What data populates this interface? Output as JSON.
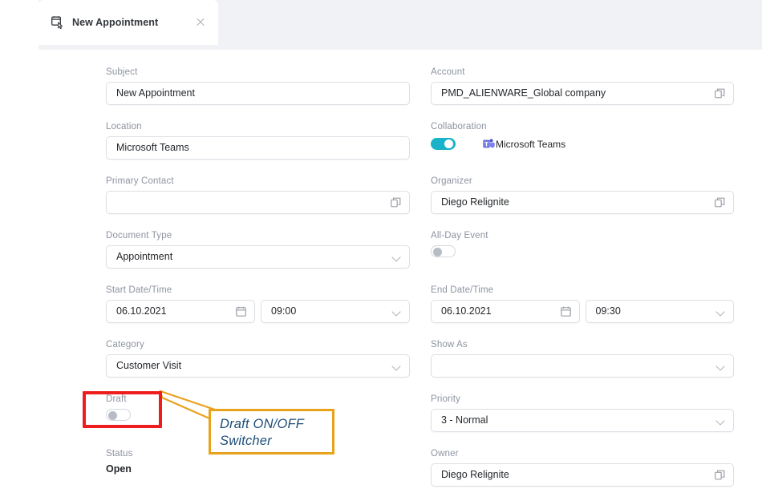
{
  "tab": {
    "label": "New Appointment",
    "icon": "appointment-icon",
    "close_icon": "close-icon"
  },
  "form": {
    "left_column": [
      {
        "label": "Subject",
        "value": "New Appointment",
        "type": "text"
      },
      {
        "label": "Location",
        "value": "Microsoft Teams",
        "type": "text"
      },
      {
        "label": "Primary Contact",
        "value": "",
        "type": "lookup",
        "icon": "value-help-icon"
      },
      {
        "label": "Document Type",
        "value": "Appointment",
        "type": "select",
        "icon": "chevron-down-icon"
      },
      {
        "label": "Start Date/Time",
        "date": "06.10.2021",
        "time": "09:00",
        "type": "datetime",
        "date_icon": "calendar-icon",
        "time_icon": "chevron-down-icon"
      },
      {
        "label": "Category",
        "value": "Customer Visit",
        "type": "select",
        "icon": "chevron-down-icon"
      },
      {
        "label": "Draft",
        "toggle": "off",
        "type": "toggle"
      },
      {
        "label": "Status",
        "value": "Open",
        "type": "readonly"
      }
    ],
    "right_column": [
      {
        "label": "Account",
        "value": "PMD_ALIENWARE_Global company",
        "type": "lookup",
        "icon": "value-help-icon"
      },
      {
        "label": "Collaboration",
        "toggle": "on",
        "app_label": "Microsoft Teams",
        "app_icon": "microsoft-teams-icon",
        "type": "toggle-app"
      },
      {
        "label": "Organizer",
        "value": "Diego Relignite",
        "type": "lookup",
        "icon": "value-help-icon"
      },
      {
        "label": "All-Day Event",
        "toggle": "off",
        "type": "toggle"
      },
      {
        "label": "End Date/Time",
        "date": "06.10.2021",
        "time": "09:30",
        "type": "datetime",
        "date_icon": "calendar-icon",
        "time_icon": "chevron-down-icon"
      },
      {
        "label": "Show As",
        "value": "",
        "type": "select",
        "icon": "chevron-down-icon"
      },
      {
        "label": "Priority",
        "value": "3 - Normal",
        "type": "select",
        "icon": "chevron-down-icon"
      },
      {
        "label": "Owner",
        "value": "Diego Relignite",
        "type": "lookup",
        "icon": "value-help-icon"
      }
    ]
  },
  "annotation": {
    "callout_text": "Draft ON/OFF\nSwitcher",
    "highlight_color": "#ee1c1c",
    "callout_border_color": "#e8a21c",
    "callout_text_color": "#1f4e79"
  },
  "colors": {
    "toggle_on": "#19b3c9",
    "toggle_off_knob": "#b7bcc6",
    "label": "#8d93a0",
    "value": "#25282c",
    "tabstrip_bg": "#f1f2f6",
    "field_border": "#dcdfe5"
  }
}
